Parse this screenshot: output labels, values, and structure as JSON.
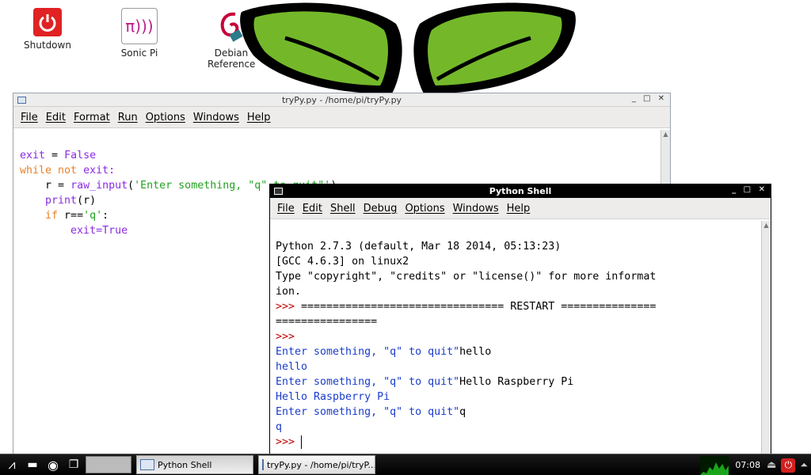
{
  "desktop": {
    "icons": [
      {
        "label": "Shutdown"
      },
      {
        "label": "Sonic Pi"
      },
      {
        "label": "Debian Reference"
      }
    ]
  },
  "editor_window": {
    "title": "tryPy.py - /home/pi/tryPy.py",
    "menus": [
      "File",
      "Edit",
      "Format",
      "Run",
      "Options",
      "Windows",
      "Help"
    ],
    "code": {
      "l1_var": "exit",
      "l1_eq": " = ",
      "l1_val": "False",
      "l2_kw1": "while",
      "l2_kw2": "not",
      "l2_rest": "exit:",
      "l3_pre": "r = ",
      "l3_fn": "raw_input",
      "l3_paren": "(",
      "l3_str": "'Enter something, \"q\" to quit\"'",
      "l3_close": ")",
      "l4_fn": "print",
      "l4_rest": "(r)",
      "l5_kw": "if",
      "l5_mid": " r==",
      "l5_str": "'q'",
      "l5_colon": ":",
      "l6_pre": "exit=",
      "l6_val": "True"
    }
  },
  "shell_window": {
    "title": "Python Shell",
    "menus": [
      "File",
      "Edit",
      "Shell",
      "Debug",
      "Options",
      "Windows",
      "Help"
    ],
    "lines": {
      "banner1": "Python 2.7.3 (default, Mar 18 2014, 05:13:23)",
      "banner2": "[GCC 4.6.3] on linux2",
      "banner3": "Type \"copyright\", \"credits\" or \"license()\" for more informat",
      "banner4": "ion.",
      "restart_prompt": ">>> ",
      "restart_a": "================================ RESTART ===============",
      "restart_b": "================",
      "prompt1": ">>> ",
      "q1": "Enter something, \"q\" to quit\"",
      "a1": "hello",
      "o1": "hello",
      "q2": "Enter something, \"q\" to quit\"",
      "a2": "Hello Raspberry Pi",
      "o2": "Hello Raspberry Pi",
      "q3": "Enter something, \"q\" to quit\"",
      "a3": "q",
      "o3": "q",
      "prompt2": ">>> "
    }
  },
  "taskbar": {
    "tasks": [
      {
        "label": "Python Shell"
      },
      {
        "label": "tryPy.py - /home/pi/tryP..."
      }
    ],
    "clock": "07:08"
  },
  "colors": {
    "keyword": "#e8812a",
    "builtin": "#8a2be2",
    "string": "#22a022",
    "prompt": "#c00000",
    "output": "#1a3ccc"
  }
}
